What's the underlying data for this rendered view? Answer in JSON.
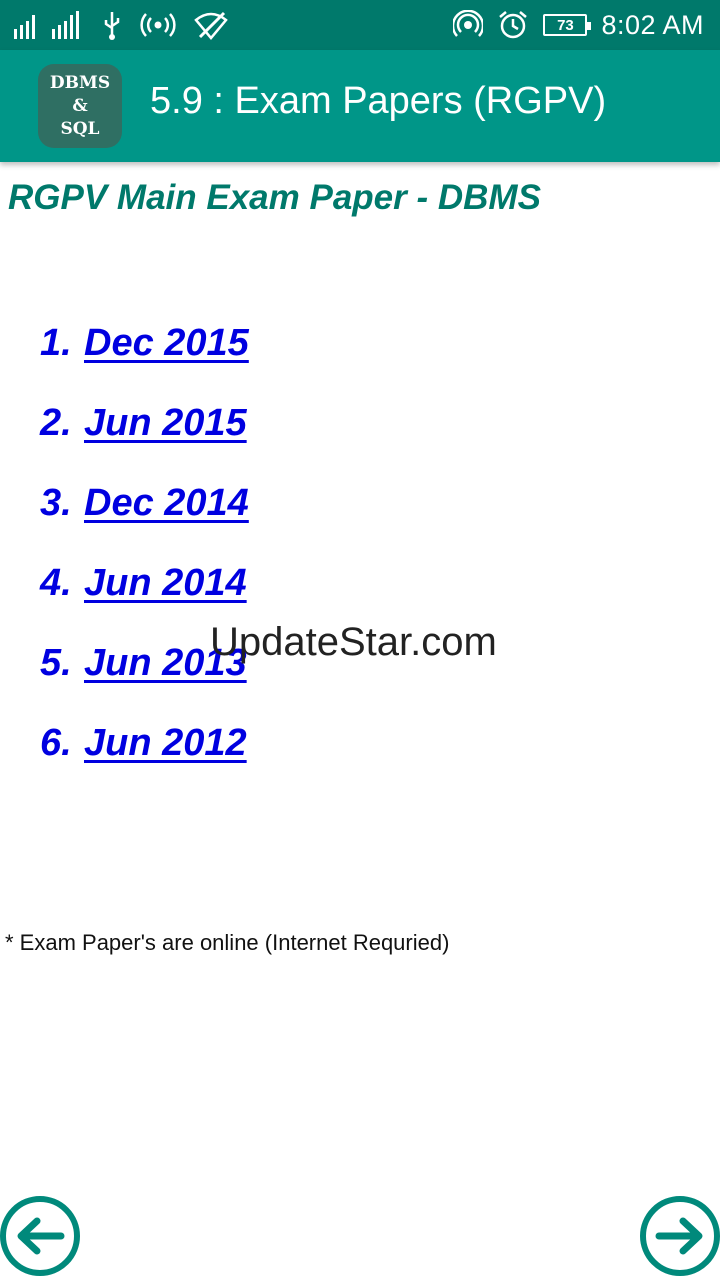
{
  "status_bar": {
    "time": "8:02 AM",
    "battery_level": "73",
    "icons": [
      "signal-icon",
      "signal-icon",
      "usb-icon",
      "hotspot-icon",
      "wifi-off-icon",
      "cast-icon",
      "alarm-icon",
      "battery-icon"
    ]
  },
  "app_bar": {
    "logo_lines": [
      "DBMS",
      "&",
      "SQL"
    ],
    "title": "5.9 : Exam Papers (RGPV)"
  },
  "content": {
    "heading": "RGPV Main Exam Paper - DBMS",
    "papers": [
      {
        "num": "1.",
        "label": "Dec 2015"
      },
      {
        "num": "2.",
        "label": "Jun 2015"
      },
      {
        "num": "3.",
        "label": "Dec 2014"
      },
      {
        "num": "4.",
        "label": "Jun 2014"
      },
      {
        "num": "5.",
        "label": "Jun 2013"
      },
      {
        "num": "6.",
        "label": "Jun 2012"
      }
    ],
    "watermark": "UpdateStar.com",
    "note": "* Exam Paper's are online (Internet Requried)"
  },
  "navigation": {
    "prev_icon": "arrow-left-icon",
    "next_icon": "arrow-right-icon"
  },
  "colors": {
    "status_bar": "#00796b",
    "app_bar": "#009688",
    "heading": "#00796b",
    "link": "#0000e0",
    "nav_ring": "#00897b"
  }
}
